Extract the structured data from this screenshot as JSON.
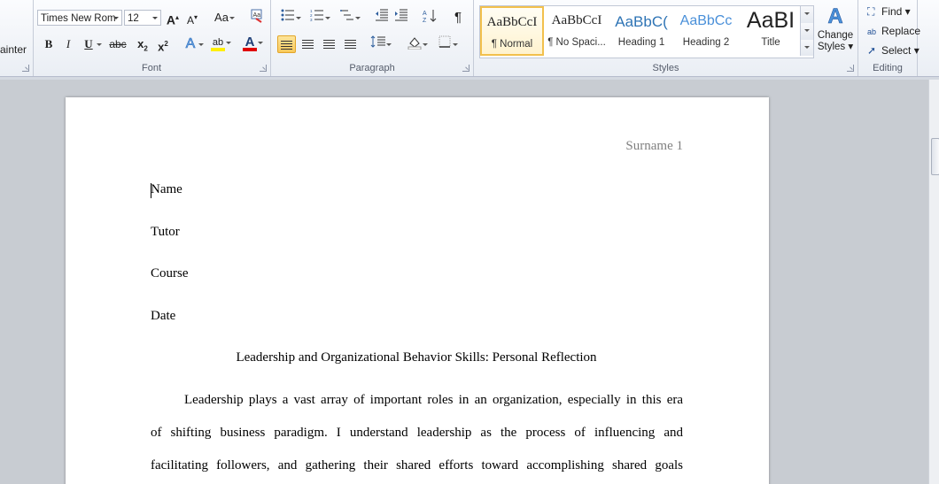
{
  "ribbon": {
    "clipboard": {
      "format_painter_label": "ainter"
    },
    "font": {
      "group_label": "Font",
      "font_name": "Times New Rom",
      "font_size": "12",
      "grow_label": "A",
      "shrink_label": "A",
      "case_label": "Aa",
      "bold": "B",
      "italic": "I",
      "underline": "U",
      "strike": "abc",
      "subscript": "x",
      "superscript": "x",
      "effects": "A",
      "highlight": "ab",
      "color": "A"
    },
    "paragraph": {
      "group_label": "Paragraph",
      "pilcrow": "¶"
    },
    "styles": {
      "group_label": "Styles",
      "items": [
        {
          "preview": "AaBbCcI",
          "name": "¶ Normal"
        },
        {
          "preview": "AaBbCcI",
          "name": "¶ No Spaci..."
        },
        {
          "preview": "AaBbC(",
          "name": "Heading 1"
        },
        {
          "preview": "AaBbCc",
          "name": "Heading 2"
        },
        {
          "preview": "AaBI",
          "name": "Title"
        }
      ],
      "change_styles": "Change Styles",
      "change_styles_line1": "Change",
      "change_styles_line2": "Styles"
    },
    "editing": {
      "group_label": "Editing",
      "find": "Find",
      "replace": "Replace",
      "select": "Select"
    },
    "colors": {
      "accent": "#f2c04c",
      "heading": "#2e74b5",
      "font_color": "#e00000",
      "highlight": "#ffef00"
    }
  },
  "document": {
    "header_text": "Surname 1",
    "lines": [
      "Name",
      "Tutor",
      "Course",
      "Date"
    ],
    "title": "Leadership and Organizational Behavior Skills: Personal Reflection",
    "body": [
      "Leadership plays a vast array of important roles in an organization, especially in this era",
      "of shifting business paradigm. I understand leadership as the process of influencing and",
      "facilitating followers, and gathering their shared efforts toward accomplishing shared goals"
    ]
  }
}
